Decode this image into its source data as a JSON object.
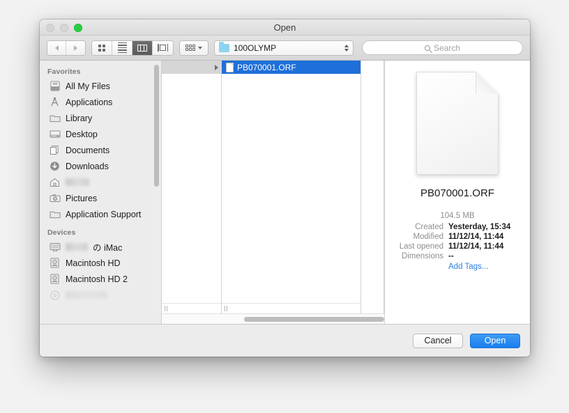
{
  "window": {
    "title": "Open",
    "traffic_lights": [
      "close-button",
      "minimize-button",
      "zoom-button"
    ]
  },
  "toolbar": {
    "back_icon": "back-arrow-icon",
    "forward_icon": "forward-arrow-icon",
    "view_modes": [
      {
        "name": "icon-view",
        "selected": false
      },
      {
        "name": "list-view",
        "selected": false
      },
      {
        "name": "column-view",
        "selected": true
      },
      {
        "name": "coverflow-view",
        "selected": false
      }
    ],
    "arrange_icon": "arrange-grid-icon",
    "path_popup": {
      "label": "100OLYMP",
      "icon": "folder-icon"
    },
    "search": {
      "placeholder": "Search",
      "value": "",
      "icon": "search-icon"
    }
  },
  "sidebar": {
    "sections": [
      {
        "title": "Favorites",
        "items": [
          {
            "label": "All My Files",
            "icon": "all-my-files-icon",
            "blurred": false
          },
          {
            "label": "Applications",
            "icon": "applications-icon",
            "blurred": false
          },
          {
            "label": "Library",
            "icon": "folder-icon",
            "blurred": false
          },
          {
            "label": "Desktop",
            "icon": "desktop-icon",
            "blurred": false
          },
          {
            "label": "Documents",
            "icon": "documents-icon",
            "blurred": false
          },
          {
            "label": "Downloads",
            "icon": "downloads-icon",
            "blurred": false
          },
          {
            "label": "",
            "icon": "home-icon",
            "blurred": true
          },
          {
            "label": "Pictures",
            "icon": "pictures-icon",
            "blurred": false
          },
          {
            "label": "Application Support",
            "icon": "folder-icon",
            "blurred": false
          }
        ]
      },
      {
        "title": "Devices",
        "items": [
          {
            "label": "の iMac",
            "icon": "imac-icon",
            "blurred": true
          },
          {
            "label": "Macintosh HD",
            "icon": "harddisk-icon",
            "blurred": false
          },
          {
            "label": "Macintosh HD 2",
            "icon": "harddisk-icon",
            "blurred": false
          }
        ]
      }
    ]
  },
  "browser": {
    "column1": {
      "selected_row_label": "",
      "has_disclosure": true
    },
    "column2": {
      "selected_file": "PB070001.ORF",
      "file_icon": "document-icon"
    },
    "column3": {
      "items": []
    }
  },
  "preview": {
    "icon": "document-icon",
    "filename": "PB070001.ORF",
    "size": "104.5 MB",
    "fields": [
      {
        "label": "Created",
        "value": "Yesterday, 15:34"
      },
      {
        "label": "Modified",
        "value": "11/12/14, 11:44"
      },
      {
        "label": "Last opened",
        "value": "11/12/14, 11:44"
      },
      {
        "label": "Dimensions",
        "value": "--"
      }
    ],
    "add_tags_label": "Add Tags..."
  },
  "footer": {
    "cancel_label": "Cancel",
    "open_label": "Open"
  },
  "colors": {
    "selection_blue": "#1e6fd9",
    "primary_button": "#1a7eee",
    "link_blue": "#2a7fe0",
    "zoom_green": "#29cc41"
  }
}
